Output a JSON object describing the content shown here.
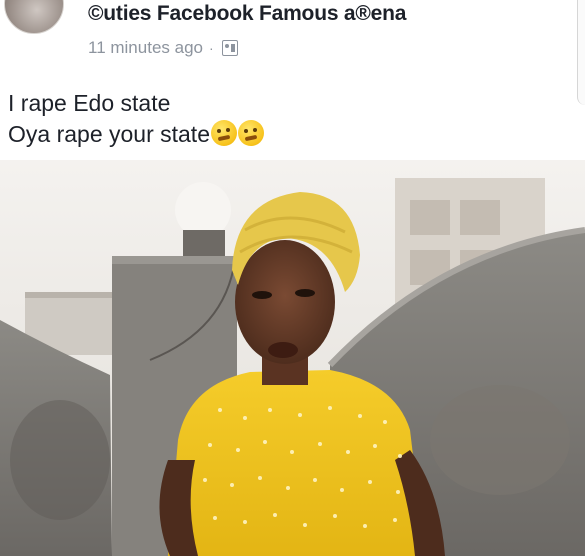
{
  "post": {
    "group_name": "©uties Facebook Famous a®ena",
    "timestamp": "11 minutes ago",
    "separator": "·",
    "audience_icon": "audience-icon",
    "text_lines": [
      "I rape Edo state",
      "Oya rape your state"
    ],
    "emojis": [
      "hugging-face-emoji",
      "hugging-face-emoji"
    ]
  },
  "colors": {
    "name": "#1d2129",
    "meta": "#8d949e",
    "shirt": "#f1c21b",
    "headwrap": "#e9c94a"
  }
}
